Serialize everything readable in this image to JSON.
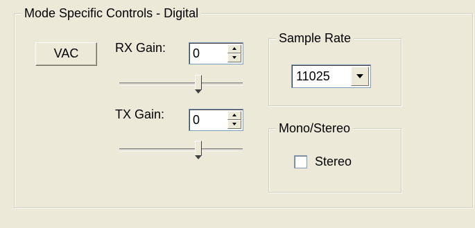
{
  "main_group": {
    "title": "Mode Specific Controls - Digital"
  },
  "vac_button": {
    "label": "VAC"
  },
  "rx": {
    "label": "RX Gain:",
    "value": "0",
    "slider_fraction": 0.65
  },
  "tx": {
    "label": "TX Gain:",
    "value": "0",
    "slider_fraction": 0.65
  },
  "sample_rate": {
    "title": "Sample Rate",
    "selected": "11025"
  },
  "mono_stereo": {
    "title": "Mono/Stereo",
    "stereo_label": "Stereo",
    "stereo_checked": false
  }
}
